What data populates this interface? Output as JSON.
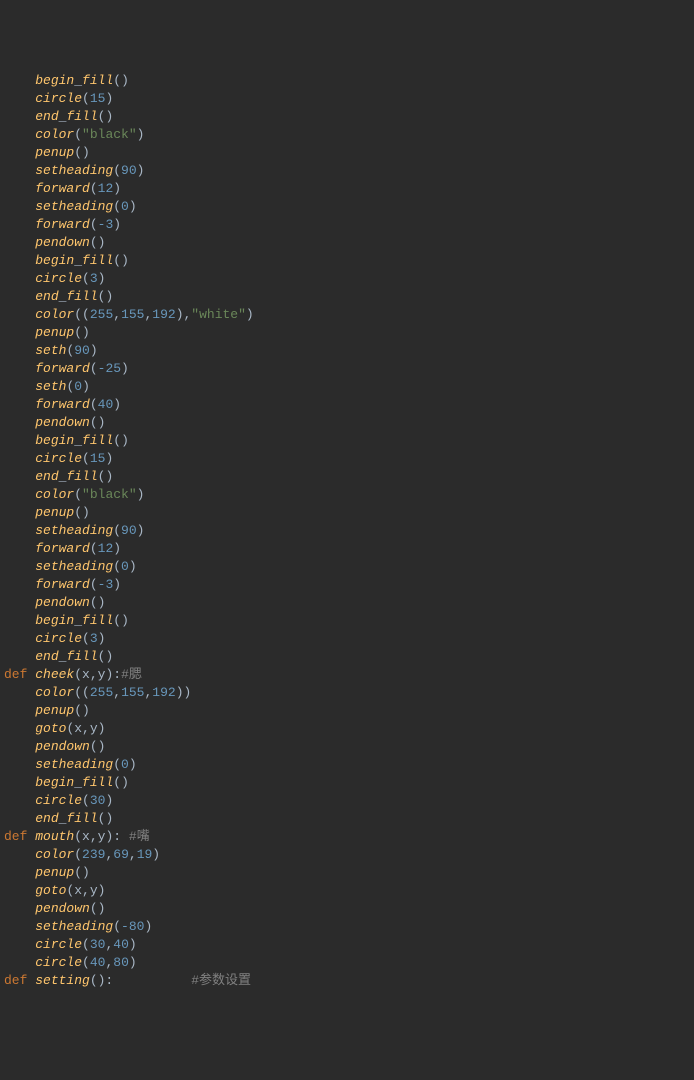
{
  "lines": [
    {
      "indent": 1,
      "tokens": [
        {
          "t": "fn",
          "v": "begin"
        },
        {
          "t": "punct",
          "v": "_"
        },
        {
          "t": "fn",
          "v": "fill"
        },
        {
          "t": "punct",
          "v": "()"
        }
      ]
    },
    {
      "indent": 1,
      "tokens": [
        {
          "t": "fn",
          "v": "circle"
        },
        {
          "t": "punct",
          "v": "("
        },
        {
          "t": "num",
          "v": "15"
        },
        {
          "t": "punct",
          "v": ")"
        }
      ]
    },
    {
      "indent": 1,
      "tokens": [
        {
          "t": "fn",
          "v": "end"
        },
        {
          "t": "punct",
          "v": "_"
        },
        {
          "t": "fn",
          "v": "fill"
        },
        {
          "t": "punct",
          "v": "()"
        }
      ]
    },
    {
      "indent": 1,
      "tokens": [
        {
          "t": "fn",
          "v": "color"
        },
        {
          "t": "punct",
          "v": "("
        },
        {
          "t": "str",
          "v": "\"black\""
        },
        {
          "t": "punct",
          "v": ")"
        }
      ]
    },
    {
      "indent": 1,
      "tokens": [
        {
          "t": "fn",
          "v": "penup"
        },
        {
          "t": "punct",
          "v": "()"
        }
      ]
    },
    {
      "indent": 1,
      "tokens": [
        {
          "t": "fn",
          "v": "setheading"
        },
        {
          "t": "punct",
          "v": "("
        },
        {
          "t": "num",
          "v": "90"
        },
        {
          "t": "punct",
          "v": ")"
        }
      ]
    },
    {
      "indent": 1,
      "tokens": [
        {
          "t": "fn",
          "v": "forward"
        },
        {
          "t": "punct",
          "v": "("
        },
        {
          "t": "num",
          "v": "12"
        },
        {
          "t": "punct",
          "v": ")"
        }
      ]
    },
    {
      "indent": 1,
      "tokens": [
        {
          "t": "fn",
          "v": "setheading"
        },
        {
          "t": "punct",
          "v": "("
        },
        {
          "t": "num",
          "v": "0"
        },
        {
          "t": "punct",
          "v": ")"
        }
      ]
    },
    {
      "indent": 1,
      "tokens": [
        {
          "t": "fn",
          "v": "forward"
        },
        {
          "t": "punct",
          "v": "("
        },
        {
          "t": "num",
          "v": "-3"
        },
        {
          "t": "punct",
          "v": ")"
        }
      ]
    },
    {
      "indent": 1,
      "tokens": [
        {
          "t": "fn",
          "v": "pendown"
        },
        {
          "t": "punct",
          "v": "()"
        }
      ]
    },
    {
      "indent": 1,
      "tokens": [
        {
          "t": "fn",
          "v": "begin"
        },
        {
          "t": "punct",
          "v": "_"
        },
        {
          "t": "fn",
          "v": "fill"
        },
        {
          "t": "punct",
          "v": "()"
        }
      ]
    },
    {
      "indent": 1,
      "tokens": [
        {
          "t": "fn",
          "v": "circle"
        },
        {
          "t": "punct",
          "v": "("
        },
        {
          "t": "num",
          "v": "3"
        },
        {
          "t": "punct",
          "v": ")"
        }
      ]
    },
    {
      "indent": 1,
      "tokens": [
        {
          "t": "fn",
          "v": "end"
        },
        {
          "t": "punct",
          "v": "_"
        },
        {
          "t": "fn",
          "v": "fill"
        },
        {
          "t": "punct",
          "v": "()"
        }
      ]
    },
    {
      "indent": 1,
      "tokens": [
        {
          "t": "fn",
          "v": "color"
        },
        {
          "t": "punct",
          "v": "(("
        },
        {
          "t": "num",
          "v": "255"
        },
        {
          "t": "punct",
          "v": ","
        },
        {
          "t": "num",
          "v": "155"
        },
        {
          "t": "punct",
          "v": ","
        },
        {
          "t": "num",
          "v": "192"
        },
        {
          "t": "punct",
          "v": "),"
        },
        {
          "t": "str",
          "v": "\"white\""
        },
        {
          "t": "punct",
          "v": ")"
        }
      ]
    },
    {
      "indent": 1,
      "tokens": [
        {
          "t": "fn",
          "v": "penup"
        },
        {
          "t": "punct",
          "v": "()"
        }
      ]
    },
    {
      "indent": 1,
      "tokens": [
        {
          "t": "fn",
          "v": "seth"
        },
        {
          "t": "punct",
          "v": "("
        },
        {
          "t": "num",
          "v": "90"
        },
        {
          "t": "punct",
          "v": ")"
        }
      ]
    },
    {
      "indent": 1,
      "tokens": [
        {
          "t": "fn",
          "v": "forward"
        },
        {
          "t": "punct",
          "v": "("
        },
        {
          "t": "num",
          "v": "-25"
        },
        {
          "t": "punct",
          "v": ")"
        }
      ]
    },
    {
      "indent": 1,
      "tokens": [
        {
          "t": "fn",
          "v": "seth"
        },
        {
          "t": "punct",
          "v": "("
        },
        {
          "t": "num",
          "v": "0"
        },
        {
          "t": "punct",
          "v": ")"
        }
      ]
    },
    {
      "indent": 1,
      "tokens": [
        {
          "t": "fn",
          "v": "forward"
        },
        {
          "t": "punct",
          "v": "("
        },
        {
          "t": "num",
          "v": "40"
        },
        {
          "t": "punct",
          "v": ")"
        }
      ]
    },
    {
      "indent": 1,
      "tokens": [
        {
          "t": "fn",
          "v": "pendown"
        },
        {
          "t": "punct",
          "v": "()"
        }
      ]
    },
    {
      "indent": 1,
      "tokens": [
        {
          "t": "fn",
          "v": "begin"
        },
        {
          "t": "punct",
          "v": "_"
        },
        {
          "t": "fn",
          "v": "fill"
        },
        {
          "t": "punct",
          "v": "()"
        }
      ]
    },
    {
      "indent": 1,
      "tokens": [
        {
          "t": "fn",
          "v": "circle"
        },
        {
          "t": "punct",
          "v": "("
        },
        {
          "t": "num",
          "v": "15"
        },
        {
          "t": "punct",
          "v": ")"
        }
      ]
    },
    {
      "indent": 1,
      "tokens": [
        {
          "t": "fn",
          "v": "end"
        },
        {
          "t": "punct",
          "v": "_"
        },
        {
          "t": "fn",
          "v": "fill"
        },
        {
          "t": "punct",
          "v": "()"
        }
      ]
    },
    {
      "indent": 1,
      "tokens": [
        {
          "t": "fn",
          "v": "color"
        },
        {
          "t": "punct",
          "v": "("
        },
        {
          "t": "str",
          "v": "\"black\""
        },
        {
          "t": "punct",
          "v": ")"
        }
      ]
    },
    {
      "indent": 1,
      "tokens": [
        {
          "t": "fn",
          "v": "penup"
        },
        {
          "t": "punct",
          "v": "()"
        }
      ]
    },
    {
      "indent": 1,
      "tokens": [
        {
          "t": "fn",
          "v": "setheading"
        },
        {
          "t": "punct",
          "v": "("
        },
        {
          "t": "num",
          "v": "90"
        },
        {
          "t": "punct",
          "v": ")"
        }
      ]
    },
    {
      "indent": 1,
      "tokens": [
        {
          "t": "fn",
          "v": "forward"
        },
        {
          "t": "punct",
          "v": "("
        },
        {
          "t": "num",
          "v": "12"
        },
        {
          "t": "punct",
          "v": ")"
        }
      ]
    },
    {
      "indent": 1,
      "tokens": [
        {
          "t": "fn",
          "v": "setheading"
        },
        {
          "t": "punct",
          "v": "("
        },
        {
          "t": "num",
          "v": "0"
        },
        {
          "t": "punct",
          "v": ")"
        }
      ]
    },
    {
      "indent": 1,
      "tokens": [
        {
          "t": "fn",
          "v": "forward"
        },
        {
          "t": "punct",
          "v": "("
        },
        {
          "t": "num",
          "v": "-3"
        },
        {
          "t": "punct",
          "v": ")"
        }
      ]
    },
    {
      "indent": 1,
      "tokens": [
        {
          "t": "fn",
          "v": "pendown"
        },
        {
          "t": "punct",
          "v": "()"
        }
      ]
    },
    {
      "indent": 1,
      "tokens": [
        {
          "t": "fn",
          "v": "begin"
        },
        {
          "t": "punct",
          "v": "_"
        },
        {
          "t": "fn",
          "v": "fill"
        },
        {
          "t": "punct",
          "v": "()"
        }
      ]
    },
    {
      "indent": 1,
      "tokens": [
        {
          "t": "fn",
          "v": "circle"
        },
        {
          "t": "punct",
          "v": "("
        },
        {
          "t": "num",
          "v": "3"
        },
        {
          "t": "punct",
          "v": ")"
        }
      ]
    },
    {
      "indent": 1,
      "tokens": [
        {
          "t": "fn",
          "v": "end"
        },
        {
          "t": "punct",
          "v": "_"
        },
        {
          "t": "fn",
          "v": "fill"
        },
        {
          "t": "punct",
          "v": "()"
        }
      ]
    },
    {
      "indent": 0,
      "tokens": [
        {
          "t": "kw",
          "v": "def "
        },
        {
          "t": "fn",
          "v": "cheek"
        },
        {
          "t": "punct",
          "v": "("
        },
        {
          "t": "param",
          "v": "x"
        },
        {
          "t": "punct",
          "v": ","
        },
        {
          "t": "param",
          "v": "y"
        },
        {
          "t": "punct",
          "v": "):"
        },
        {
          "t": "comment",
          "v": "#腮"
        }
      ]
    },
    {
      "indent": 1,
      "tokens": [
        {
          "t": "fn",
          "v": "color"
        },
        {
          "t": "punct",
          "v": "(("
        },
        {
          "t": "num",
          "v": "255"
        },
        {
          "t": "punct",
          "v": ","
        },
        {
          "t": "num",
          "v": "155"
        },
        {
          "t": "punct",
          "v": ","
        },
        {
          "t": "num",
          "v": "192"
        },
        {
          "t": "punct",
          "v": "))"
        }
      ]
    },
    {
      "indent": 1,
      "tokens": [
        {
          "t": "fn",
          "v": "penup"
        },
        {
          "t": "punct",
          "v": "()"
        }
      ]
    },
    {
      "indent": 1,
      "tokens": [
        {
          "t": "fn",
          "v": "goto"
        },
        {
          "t": "punct",
          "v": "(x,y)"
        }
      ]
    },
    {
      "indent": 1,
      "tokens": [
        {
          "t": "fn",
          "v": "pendown"
        },
        {
          "t": "punct",
          "v": "()"
        }
      ]
    },
    {
      "indent": 1,
      "tokens": [
        {
          "t": "fn",
          "v": "setheading"
        },
        {
          "t": "punct",
          "v": "("
        },
        {
          "t": "num",
          "v": "0"
        },
        {
          "t": "punct",
          "v": ")"
        }
      ]
    },
    {
      "indent": 1,
      "tokens": [
        {
          "t": "fn",
          "v": "begin"
        },
        {
          "t": "punct",
          "v": "_"
        },
        {
          "t": "fn",
          "v": "fill"
        },
        {
          "t": "punct",
          "v": "()"
        }
      ]
    },
    {
      "indent": 1,
      "tokens": [
        {
          "t": "fn",
          "v": "circle"
        },
        {
          "t": "punct",
          "v": "("
        },
        {
          "t": "num",
          "v": "30"
        },
        {
          "t": "punct",
          "v": ")"
        }
      ]
    },
    {
      "indent": 1,
      "tokens": [
        {
          "t": "fn",
          "v": "end"
        },
        {
          "t": "punct",
          "v": "_"
        },
        {
          "t": "fn",
          "v": "fill"
        },
        {
          "t": "punct",
          "v": "()"
        }
      ]
    },
    {
      "indent": 0,
      "tokens": [
        {
          "t": "kw",
          "v": "def "
        },
        {
          "t": "fn",
          "v": "mouth"
        },
        {
          "t": "punct",
          "v": "("
        },
        {
          "t": "param",
          "v": "x"
        },
        {
          "t": "punct",
          "v": ","
        },
        {
          "t": "param",
          "v": "y"
        },
        {
          "t": "punct",
          "v": "): "
        },
        {
          "t": "comment",
          "v": "#嘴"
        }
      ]
    },
    {
      "indent": 1,
      "tokens": [
        {
          "t": "fn",
          "v": "color"
        },
        {
          "t": "punct",
          "v": "("
        },
        {
          "t": "num",
          "v": "239"
        },
        {
          "t": "punct",
          "v": ","
        },
        {
          "t": "num",
          "v": "69"
        },
        {
          "t": "punct",
          "v": ","
        },
        {
          "t": "num",
          "v": "19"
        },
        {
          "t": "punct",
          "v": ")"
        }
      ]
    },
    {
      "indent": 1,
      "tokens": [
        {
          "t": "fn",
          "v": "penup"
        },
        {
          "t": "punct",
          "v": "()"
        }
      ]
    },
    {
      "indent": 1,
      "tokens": [
        {
          "t": "fn",
          "v": "goto"
        },
        {
          "t": "punct",
          "v": "(x,y)"
        }
      ]
    },
    {
      "indent": 1,
      "tokens": [
        {
          "t": "fn",
          "v": "pendown"
        },
        {
          "t": "punct",
          "v": "()"
        }
      ]
    },
    {
      "indent": 1,
      "tokens": [
        {
          "t": "fn",
          "v": "setheading"
        },
        {
          "t": "punct",
          "v": "("
        },
        {
          "t": "num",
          "v": "-80"
        },
        {
          "t": "punct",
          "v": ")"
        }
      ]
    },
    {
      "indent": 1,
      "tokens": [
        {
          "t": "fn",
          "v": "circle"
        },
        {
          "t": "punct",
          "v": "("
        },
        {
          "t": "num",
          "v": "30"
        },
        {
          "t": "punct",
          "v": ","
        },
        {
          "t": "num",
          "v": "40"
        },
        {
          "t": "punct",
          "v": ")"
        }
      ]
    },
    {
      "indent": 1,
      "tokens": [
        {
          "t": "fn",
          "v": "circle"
        },
        {
          "t": "punct",
          "v": "("
        },
        {
          "t": "num",
          "v": "40"
        },
        {
          "t": "punct",
          "v": ","
        },
        {
          "t": "num",
          "v": "80"
        },
        {
          "t": "punct",
          "v": ")"
        }
      ]
    },
    {
      "indent": 0,
      "tokens": [
        {
          "t": "kw",
          "v": "def "
        },
        {
          "t": "fn",
          "v": "setting"
        },
        {
          "t": "punct",
          "v": "():          "
        },
        {
          "t": "comment",
          "v": "#参数设置"
        }
      ]
    }
  ]
}
